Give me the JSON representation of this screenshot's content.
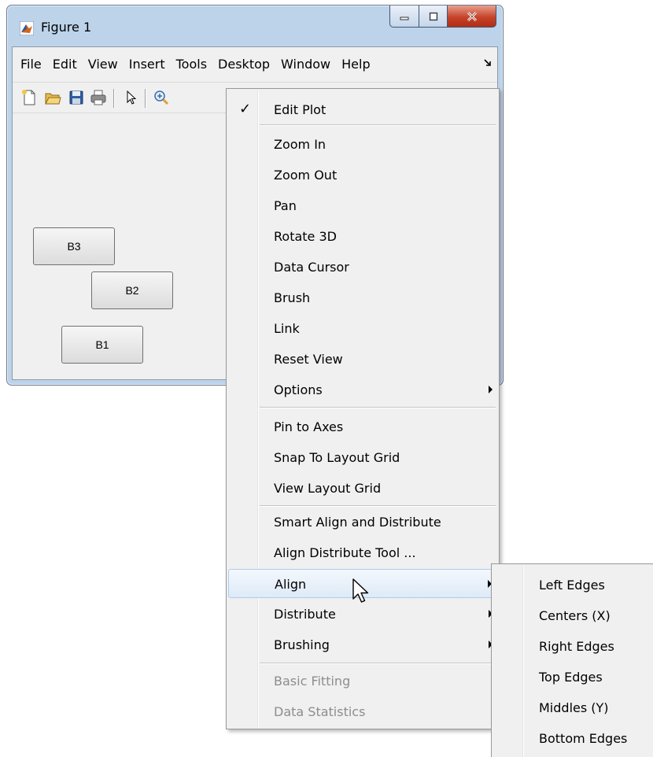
{
  "window": {
    "title": "Figure 1",
    "close_label": "X"
  },
  "menubar": {
    "items": [
      "File",
      "Edit",
      "View",
      "Insert",
      "Tools",
      "Desktop",
      "Window",
      "Help"
    ]
  },
  "toolbar": {
    "icons": [
      "new-figure-icon",
      "open-file-icon",
      "save-icon",
      "print-icon",
      "pointer-icon",
      "zoom-in-icon"
    ]
  },
  "canvas": {
    "buttons": [
      {
        "label": "B3"
      },
      {
        "label": "B2"
      },
      {
        "label": "B1"
      }
    ]
  },
  "tools_menu": {
    "checked_item": "Edit Plot",
    "items": [
      {
        "label": "Edit Plot",
        "checked": true
      },
      {
        "label": "Zoom In"
      },
      {
        "label": "Zoom Out"
      },
      {
        "label": "Pan"
      },
      {
        "label": "Rotate 3D"
      },
      {
        "label": "Data Cursor"
      },
      {
        "label": "Brush"
      },
      {
        "label": "Link"
      },
      {
        "label": "Reset View"
      },
      {
        "label": "Options",
        "submenu": true
      },
      {
        "label": "Pin to Axes"
      },
      {
        "label": "Snap To Layout Grid"
      },
      {
        "label": "View Layout Grid"
      },
      {
        "label": "Smart Align and Distribute"
      },
      {
        "label": "Align Distribute Tool ..."
      },
      {
        "label": "Align",
        "submenu": true,
        "highlighted": true
      },
      {
        "label": "Distribute",
        "submenu": true
      },
      {
        "label": "Brushing",
        "submenu": true
      },
      {
        "label": "Basic Fitting",
        "disabled": true
      },
      {
        "label": "Data Statistics",
        "disabled": true
      }
    ]
  },
  "align_submenu": {
    "items": [
      "Left Edges",
      "Centers (X)",
      "Right Edges",
      "Top Edges",
      "Middles (Y)",
      "Bottom Edges"
    ]
  },
  "colors": {
    "menu_bg": "#f0f0f0",
    "highlight_border": "#aecbf0",
    "disabled_text": "#8d8d8d",
    "close_button": "#c6432a"
  }
}
